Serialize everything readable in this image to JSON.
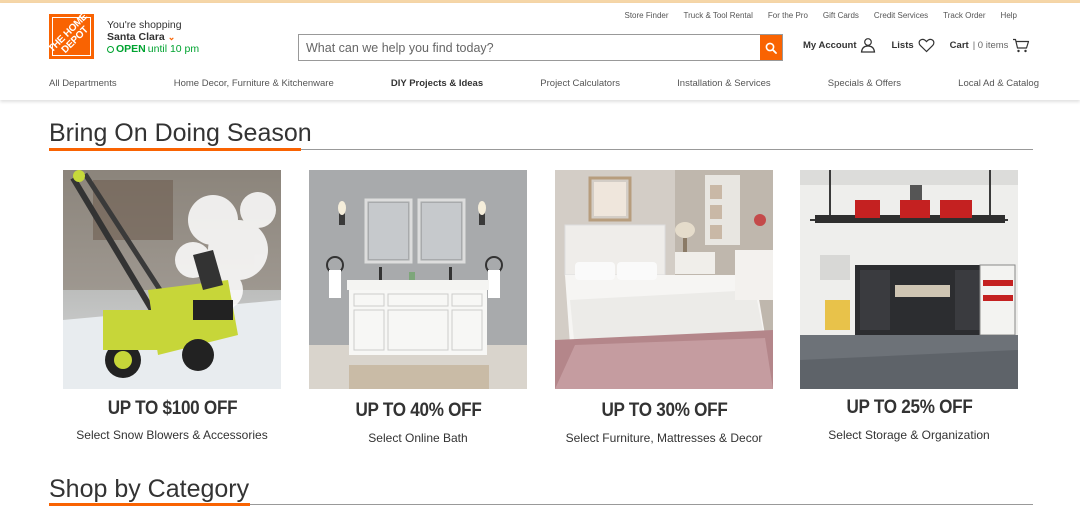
{
  "store": {
    "shopping_label": "You're shopping",
    "city": "Santa Clara",
    "open_label": "OPEN",
    "hours": "until 10 pm"
  },
  "logo_text": "THE HOME DEPOT",
  "utility_links": [
    "Store Finder",
    "Truck & Tool Rental",
    "For the Pro",
    "Gift Cards",
    "Credit Services",
    "Track Order",
    "Help"
  ],
  "search": {
    "placeholder": "What can we help you find today?"
  },
  "account": {
    "my_account": "My Account",
    "lists": "Lists",
    "cart": "Cart",
    "cart_count": "0 items"
  },
  "nav": [
    "All Departments",
    "Home Decor, Furniture & Kitchenware",
    "DIY Projects & Ideas",
    "Project Calculators",
    "Installation & Services",
    "Specials & Offers",
    "Local Ad & Catalog"
  ],
  "sections": {
    "promo_title": "Bring On Doing Season",
    "category_title": "Shop by Category"
  },
  "promos": [
    {
      "offer": "UP TO $100 OFF",
      "description": "Select Snow Blowers & Accessories",
      "image": "snow-blower-image"
    },
    {
      "offer": "UP TO 40% OFF",
      "description": "Select Online Bath",
      "image": "bathroom-vanity-image"
    },
    {
      "offer": "UP TO 30% OFF",
      "description": "Select Furniture, Mattresses & Decor",
      "image": "bedroom-image"
    },
    {
      "offer": "UP TO 25% OFF",
      "description": "Select Storage & Organization",
      "image": "garage-storage-image"
    }
  ],
  "colors": {
    "brand": "#f96302",
    "open": "#00a330",
    "text": "#333333"
  }
}
